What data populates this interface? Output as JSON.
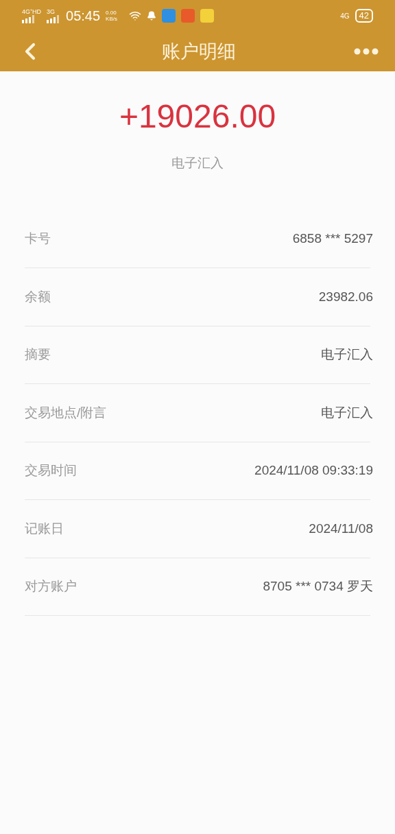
{
  "status_bar": {
    "sim1": "4G⁺HD",
    "sim2": "3G",
    "time": "05:45",
    "speed": "0.00 KB/s",
    "network": "4G",
    "battery": "42"
  },
  "header": {
    "title": "账户明细"
  },
  "amount": {
    "value": "+19026.00",
    "type": "电子汇入"
  },
  "details": [
    {
      "label": "卡号",
      "value": "6858 *** 5297"
    },
    {
      "label": "余额",
      "value": "23982.06"
    },
    {
      "label": "摘要",
      "value": "电子汇入"
    },
    {
      "label": "交易地点/附言",
      "value": "电子汇入"
    },
    {
      "label": "交易时间",
      "value": "2024/11/08 09:33:19"
    },
    {
      "label": "记账日",
      "value": "2024/11/08"
    },
    {
      "label": "对方账户",
      "value": "8705 *** 0734 罗天"
    }
  ]
}
